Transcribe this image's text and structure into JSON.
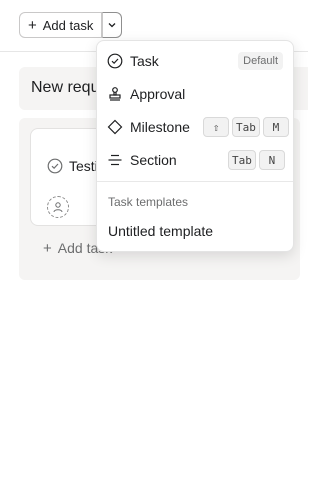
{
  "toolbar": {
    "add_task_label": "Add task",
    "plus_icon": "+",
    "caret_icon": "chevron-down-icon"
  },
  "section": {
    "title": "New requ"
  },
  "card": {
    "title": "Testi"
  },
  "column": {
    "add_task_label": "Add task",
    "plus_icon": "+"
  },
  "menu": {
    "items": [
      {
        "label": "Task",
        "icon": "check-circle-icon",
        "badge": "Default"
      },
      {
        "label": "Approval",
        "icon": "stamp-icon"
      },
      {
        "label": "Milestone",
        "icon": "diamond-icon",
        "keys": [
          "⇧",
          "Tab",
          "M"
        ]
      },
      {
        "label": "Section",
        "icon": "section-lines-icon",
        "keys": [
          "Tab",
          "N"
        ]
      }
    ],
    "templates_header": "Task templates",
    "template_item": "Untitled template"
  }
}
